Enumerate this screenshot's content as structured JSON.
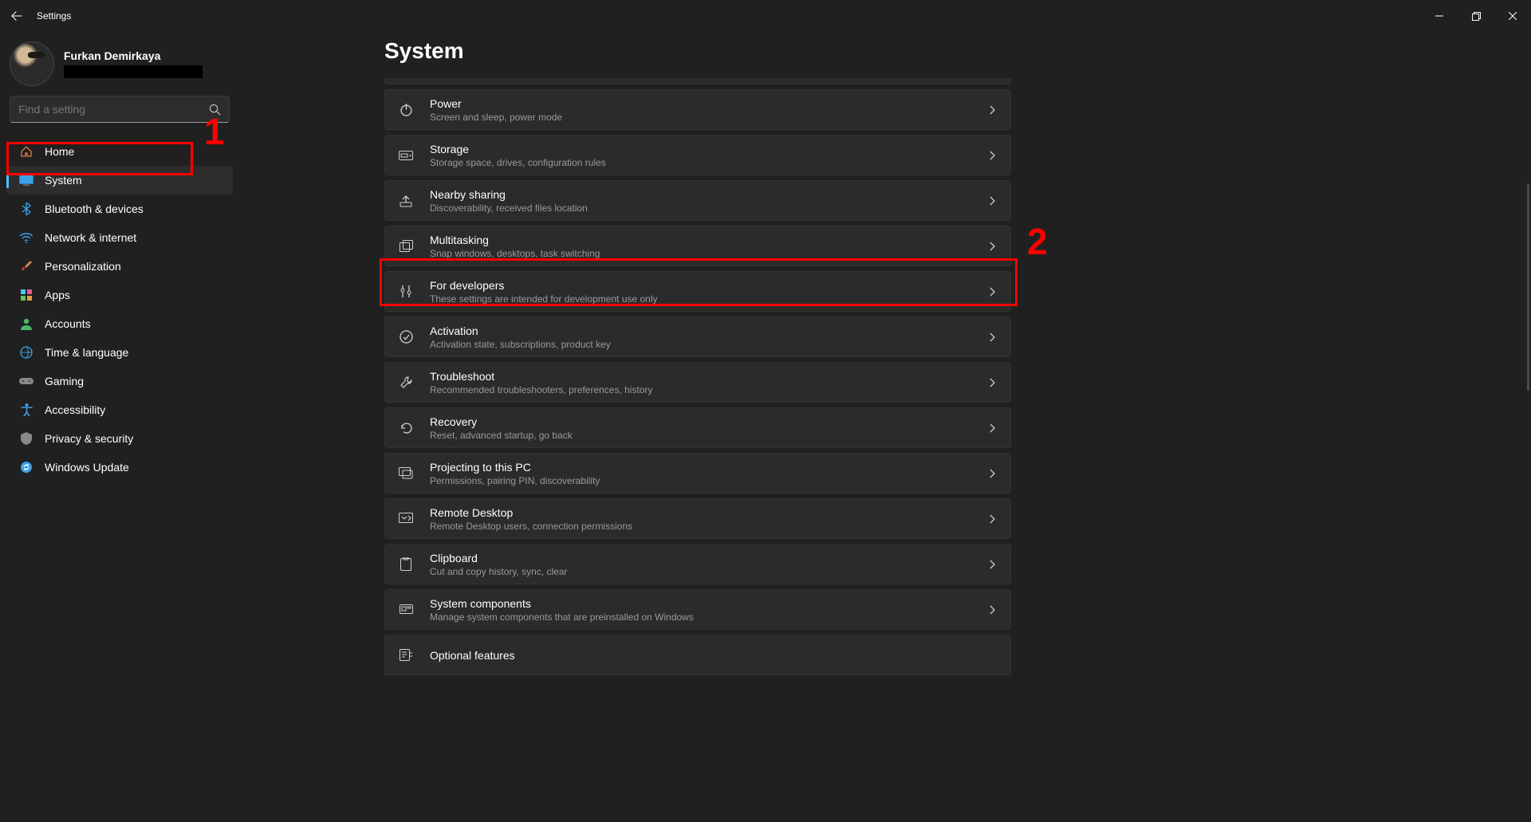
{
  "window": {
    "title": "Settings"
  },
  "profile": {
    "name": "Furkan Demirkaya"
  },
  "search": {
    "placeholder": "Find a setting"
  },
  "nav": {
    "home": "Home",
    "system": "System",
    "bluetooth": "Bluetooth & devices",
    "network": "Network & internet",
    "personalization": "Personalization",
    "apps": "Apps",
    "accounts": "Accounts",
    "time": "Time & language",
    "gaming": "Gaming",
    "accessibility": "Accessibility",
    "privacy": "Privacy & security",
    "update": "Windows Update"
  },
  "page": {
    "title": "System"
  },
  "cards": {
    "power": {
      "title": "Power",
      "sub": "Screen and sleep, power mode"
    },
    "storage": {
      "title": "Storage",
      "sub": "Storage space, drives, configuration rules"
    },
    "nearby": {
      "title": "Nearby sharing",
      "sub": "Discoverability, received files location"
    },
    "multitask": {
      "title": "Multitasking",
      "sub": "Snap windows, desktops, task switching"
    },
    "developers": {
      "title": "For developers",
      "sub": "These settings are intended for development use only"
    },
    "activation": {
      "title": "Activation",
      "sub": "Activation state, subscriptions, product key"
    },
    "troubleshoot": {
      "title": "Troubleshoot",
      "sub": "Recommended troubleshooters, preferences, history"
    },
    "recovery": {
      "title": "Recovery",
      "sub": "Reset, advanced startup, go back"
    },
    "projecting": {
      "title": "Projecting to this PC",
      "sub": "Permissions, pairing PIN, discoverability"
    },
    "remote": {
      "title": "Remote Desktop",
      "sub": "Remote Desktop users, connection permissions"
    },
    "clipboard": {
      "title": "Clipboard",
      "sub": "Cut and copy history, sync, clear"
    },
    "components": {
      "title": "System components",
      "sub": "Manage system components that are preinstalled on Windows"
    },
    "optional": {
      "title": "Optional features",
      "sub": ""
    }
  },
  "annotations": {
    "one": "1",
    "two": "2"
  }
}
